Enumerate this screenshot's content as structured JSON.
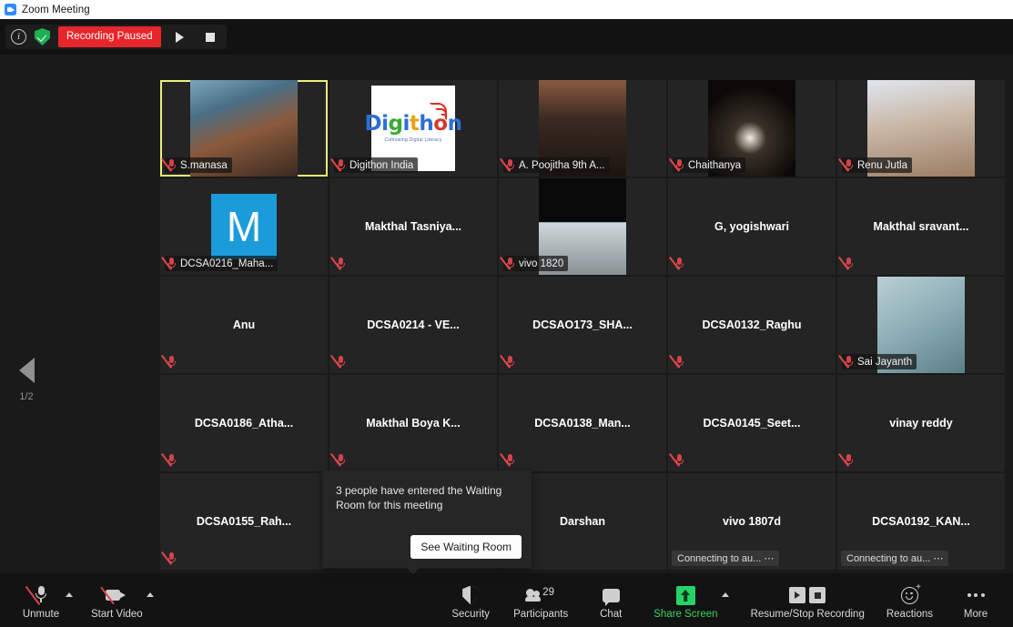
{
  "window": {
    "title": "Zoom Meeting",
    "logo_icon": "zoom-logo-icon"
  },
  "recording_bar": {
    "info_icon": "info-icon",
    "security_shield_icon": "shield-check-icon",
    "status_label": "Recording Paused",
    "resume_icon": "play-icon",
    "stop_icon": "stop-icon"
  },
  "gallery": {
    "prev_page_icon": "left-arrow-icon",
    "page_indicator": "1/2",
    "tiles": [
      {
        "name": "S.manasa",
        "kind": "video",
        "muted": true,
        "active": true,
        "badge_shaded": true
      },
      {
        "name": "Digithon India",
        "kind": "logo",
        "muted": true,
        "active": false,
        "badge_shaded": true
      },
      {
        "name": "A. Poojitha 9th A...",
        "kind": "video",
        "muted": true,
        "active": false,
        "badge_shaded": true
      },
      {
        "name": "Chaithanya",
        "kind": "video",
        "muted": true,
        "active": false,
        "badge_shaded": true
      },
      {
        "name": "Renu Jutla",
        "kind": "video",
        "muted": true,
        "active": false,
        "badge_shaded": true
      },
      {
        "name": "DCSA0216_Maha...",
        "kind": "avatar",
        "avatar_letter": "M",
        "avatar_color": "#1b9bda",
        "muted": true,
        "active": false,
        "badge_shaded": true
      },
      {
        "name": "Makthal  Tasniya...",
        "kind": "name",
        "muted": true,
        "active": false
      },
      {
        "name": "vivo 1820",
        "kind": "video",
        "muted": true,
        "active": false,
        "badge_shaded": true
      },
      {
        "name": "G, yogishwari",
        "kind": "name",
        "muted": true,
        "active": false
      },
      {
        "name": "Makthal  sravant...",
        "kind": "name",
        "muted": true,
        "active": false
      },
      {
        "name": "Anu",
        "kind": "name",
        "muted": true,
        "active": false
      },
      {
        "name": "DCSA0214 - VE...",
        "kind": "name",
        "muted": true,
        "active": false
      },
      {
        "name": "DCSAO173_SHA...",
        "kind": "name",
        "muted": true,
        "active": false
      },
      {
        "name": "DCSA0132_Raghu",
        "kind": "name",
        "muted": true,
        "active": false
      },
      {
        "name": "Sai Jayanth",
        "kind": "video",
        "muted": true,
        "active": false,
        "badge_shaded": true
      },
      {
        "name": "DCSA0186_Atha...",
        "kind": "name",
        "muted": true,
        "active": false
      },
      {
        "name": "Makthal  Boya K...",
        "kind": "name",
        "muted": true,
        "active": false
      },
      {
        "name": "DCSA0138_Man...",
        "kind": "name",
        "muted": true,
        "active": false
      },
      {
        "name": "DCSA0145_Seet...",
        "kind": "name",
        "muted": true,
        "active": false
      },
      {
        "name": "vinay reddy",
        "kind": "name",
        "muted": true,
        "active": false
      },
      {
        "name": "DCSA0155_Rah...",
        "kind": "name",
        "muted": true,
        "active": false
      },
      {
        "name": "",
        "kind": "name",
        "muted": false,
        "active": false
      },
      {
        "name": "Darshan",
        "kind": "name",
        "muted": false,
        "active": false
      },
      {
        "name": "vivo 1807d",
        "kind": "name",
        "muted": false,
        "active": false,
        "status": "Connecting to au... ⋯"
      },
      {
        "name": "DCSA0192_KAN...",
        "kind": "name",
        "muted": false,
        "active": false,
        "status": "Connecting to au... ⋯"
      }
    ],
    "logo_tile": {
      "word_letters": [
        "D",
        "i",
        "g",
        "i",
        "t",
        "h",
        "o",
        "n"
      ],
      "tagline": "Cultivating Digital Literacy",
      "wifi_icon": "wifi-arcs-icon"
    }
  },
  "waiting_room_toast": {
    "message": "3 people have entered the Waiting Room for this meeting",
    "button_label": "See Waiting Room"
  },
  "toolbar": {
    "left": [
      {
        "label": "Unmute",
        "icon": "microphone-muted-icon",
        "has_caret": true,
        "accent": false
      },
      {
        "label": "Start Video",
        "icon": "camera-off-icon",
        "has_caret": true,
        "accent": false
      }
    ],
    "right": [
      {
        "label": "Security",
        "icon": "shield-icon",
        "has_caret": false,
        "accent": false
      },
      {
        "label": "Participants",
        "icon": "participants-icon",
        "has_caret": false,
        "accent": false,
        "count": "29"
      },
      {
        "label": "Chat",
        "icon": "chat-bubble-icon",
        "has_caret": false,
        "accent": false
      },
      {
        "label": "Share Screen",
        "icon": "share-screen-icon",
        "has_caret": true,
        "accent": true
      },
      {
        "label": "Resume/Stop Recording",
        "icon": "record-controls-icon",
        "has_caret": false,
        "accent": false
      },
      {
        "label": "Reactions",
        "icon": "reactions-icon",
        "has_caret": false,
        "accent": false
      },
      {
        "label": "More",
        "icon": "more-dots-icon",
        "has_caret": false,
        "accent": false
      }
    ]
  },
  "colors": {
    "recording_red": "#e8252a",
    "active_speaker_border": "#e9f07a",
    "share_green": "#3ad15f",
    "avatar_blue": "#1b9bda",
    "mute_red": "#d4434a"
  }
}
